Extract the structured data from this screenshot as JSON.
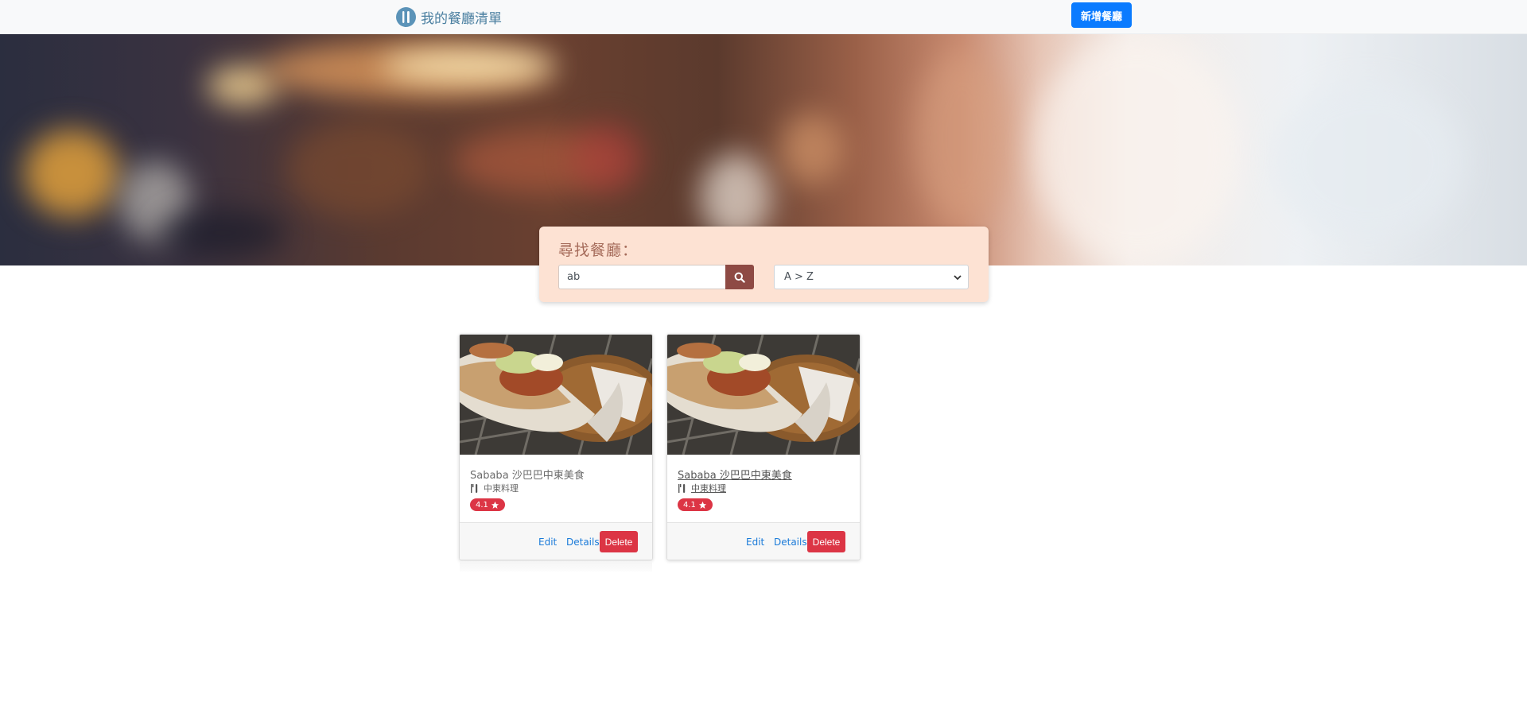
{
  "navbar": {
    "brand_label": "我的餐廳清單",
    "brand_icon": "utensils-icon",
    "add_button_label": "新增餐廳",
    "accent": "#0a7bff"
  },
  "search": {
    "title": "尋找餐廳：",
    "input_value": "ab",
    "button_icon": "search-icon",
    "sort_selected": "A > Z"
  },
  "restaurants": [
    {
      "name": "Sababa 沙巴巴中東美食",
      "category": "中東料理",
      "rating": "4.1",
      "edit_label": "Edit",
      "details_label": "Details",
      "delete_label": "Delete"
    },
    {
      "name": "Sababa 沙巴巴中東美食",
      "category": "中東料理",
      "rating": "4.1",
      "edit_label": "Edit",
      "details_label": "Details",
      "delete_label": "Delete"
    }
  ],
  "colors": {
    "search_panel": "#fde2d3",
    "search_button": "#8e4a44",
    "danger": "#dc3545",
    "link": "#1a7ad9"
  }
}
